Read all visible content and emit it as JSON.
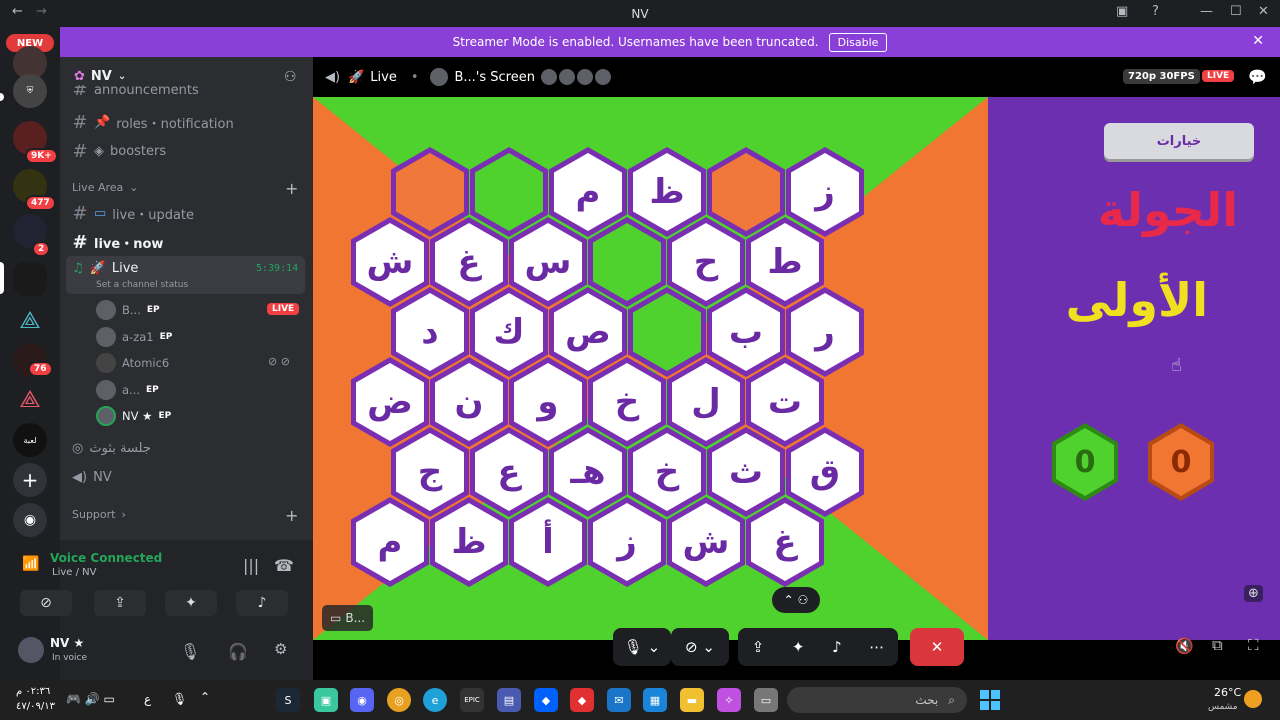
{
  "window": {
    "title": "NV"
  },
  "server_badges": {
    "new": "NEW",
    "b1": "9K+",
    "b2": "477",
    "b3": "2",
    "b4": "76",
    "label_last": "لعبة"
  },
  "banner": {
    "text": "Streamer Mode is enabled. Usernames have been truncated.",
    "button": "Disable"
  },
  "server": {
    "name": "NV"
  },
  "channels": {
    "announcements_partial": "announcements",
    "roles": "roles・notification",
    "boosters": "boosters",
    "category_live": "Live Area",
    "live_update": "live・update",
    "live_now": "live・now",
    "voice_live": "Live",
    "voice_timer": "5:39:14",
    "set_status": "Set a channel status",
    "voice_arabic": "جلسة بثوث",
    "voice_nv": "NV",
    "category_support": "Support"
  },
  "voice_users": [
    {
      "name": "B...",
      "tag": "EP",
      "live": "LIVE"
    },
    {
      "name": "a-za1",
      "tag": "EP"
    },
    {
      "name": "Atomic6",
      "tag": ""
    },
    {
      "name": "a...",
      "tag": "EP"
    },
    {
      "name": "NV ★",
      "tag": "EP"
    }
  ],
  "voice_status": {
    "title": "Voice Connected",
    "sub": "Live / NV"
  },
  "user": {
    "name": "NV ★",
    "status": "In voice"
  },
  "stage": {
    "channel": "Live",
    "screen": "B...'s Screen",
    "quality": "720p 30FPS",
    "live": "LIVE",
    "stream_label": "B..."
  },
  "game": {
    "rows": [
      [
        "",
        "",
        "م",
        "ظ",
        "",
        "ز"
      ],
      [
        "ش",
        "غ",
        "س",
        "",
        "ح",
        "ط"
      ],
      [
        "د",
        "ك",
        "ص",
        "",
        "ب",
        "ر"
      ],
      [
        "ض",
        "ن",
        "و",
        "خ",
        "ل",
        "ت"
      ],
      [
        "ج",
        "ع",
        "هـ",
        "خ",
        "ث",
        "ق"
      ],
      [
        "م",
        "ظ",
        "أ",
        "ز",
        "ش",
        "غ"
      ]
    ],
    "fills": [
      [
        "o",
        "g",
        "w",
        "w",
        "o",
        "w"
      ],
      [
        "w",
        "w",
        "w",
        "g",
        "w",
        "w"
      ],
      [
        "w",
        "w",
        "w",
        "g",
        "w",
        "w"
      ],
      [
        "w",
        "w",
        "w",
        "w",
        "w",
        "w"
      ],
      [
        "w",
        "w",
        "w",
        "w",
        "w",
        "w"
      ],
      [
        "w",
        "w",
        "w",
        "w",
        "w",
        "w"
      ]
    ],
    "options_button": "خيارات",
    "round_line1": "الجولة",
    "round_line2": "الأولى",
    "score_green": "0",
    "score_orange": "0"
  },
  "taskbar": {
    "time": "٠٢:٣٦ م",
    "date": "٤٧/٠٩/١٣",
    "weather": "26°C",
    "weather_sub": "مشمس",
    "search": "بحث",
    "lang": "ع"
  }
}
